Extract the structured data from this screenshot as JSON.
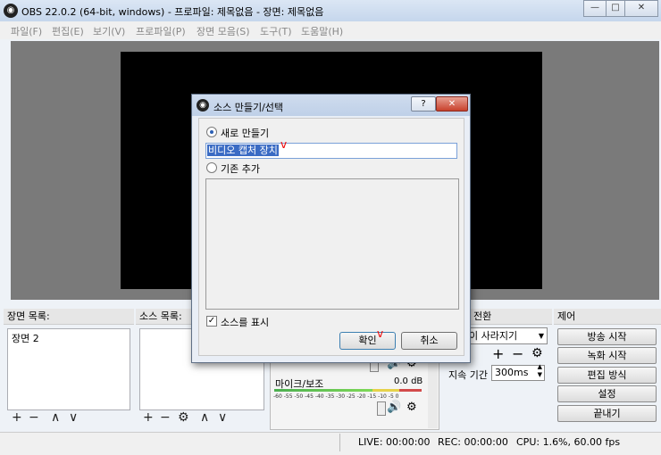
{
  "window": {
    "title": "OBS 22.0.2 (64-bit, windows) - 프로파일: 제목없음 - 장면: 제목없음",
    "minimize": "—",
    "maximize": "□",
    "close": "✕"
  },
  "menu": [
    "파일(F)",
    "편집(E)",
    "보기(V)",
    "프로파일(P)",
    "장면 모음(S)",
    "도구(T)",
    "도움말(H)"
  ],
  "scenes": {
    "label": "장면 목록:",
    "items": [
      "장면 2"
    ]
  },
  "sources": {
    "label": "소스 목록:"
  },
  "transition": {
    "label_tail": "전환",
    "type": "페이드 사라지기",
    "type_visible": "이 사라지기",
    "duration_label": "지속 기간",
    "duration": "300ms"
  },
  "controls": {
    "label": "제어",
    "buttons": [
      "방송 시작",
      "녹화 시작",
      "편집 방식",
      "설정",
      "끝내기"
    ]
  },
  "mixer": {
    "channel_name": "마이크/보조",
    "level": "0.0 dB",
    "scale": "-60 -55 -50 -45 -40 -35 -30 -25 -20 -15 -10 -5 0"
  },
  "status": {
    "live": "LIVE: 00:00:00",
    "rec": "REC: 00:00:00",
    "cpu": "CPU: 1.6%, 60.00 fps"
  },
  "dialog": {
    "title": "소스 만들기/선택",
    "help": "?",
    "close": "✕",
    "create_new": "새로 만들기",
    "name_value": "비디오 캡처 장치",
    "add_existing": "기존 추가",
    "show_source": "소스를 표시",
    "ok": "확인",
    "cancel": "취소",
    "annotation": "v"
  },
  "icons": [
    "obs-logo-icon",
    "plus-icon",
    "minus-icon",
    "up-icon",
    "down-icon",
    "gear-icon",
    "speaker-icon"
  ]
}
